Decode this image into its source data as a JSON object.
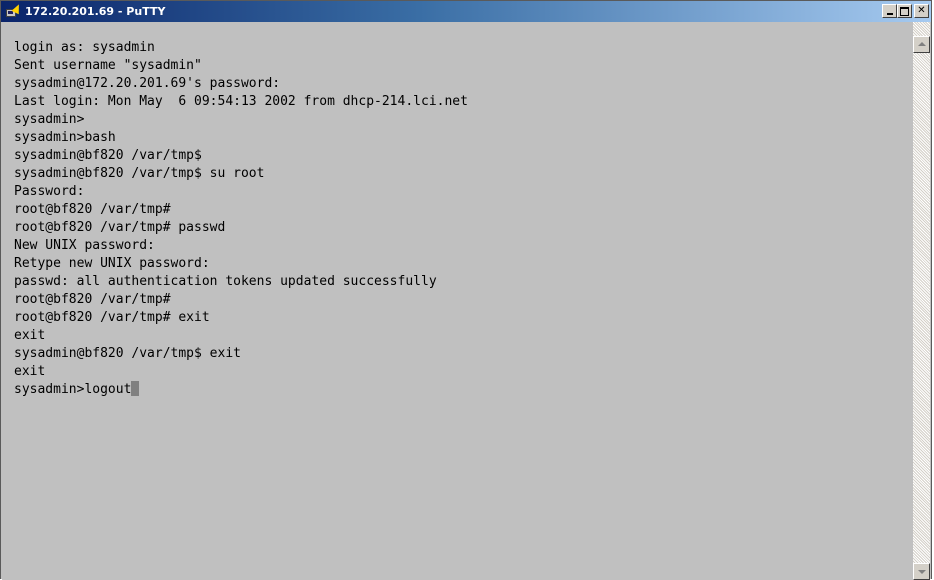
{
  "window": {
    "title": "172.20.201.69 - PuTTY",
    "icon": "putty-icon",
    "controls": [
      "minimize",
      "maximize",
      "close"
    ]
  },
  "terminal": {
    "lines": [
      "login as: sysadmin",
      "Sent username \"sysadmin\"",
      "sysadmin@172.20.201.69's password:",
      "Last login: Mon May  6 09:54:13 2002 from dhcp-214.lci.net",
      "sysadmin>",
      "sysadmin>bash",
      "sysadmin@bf820 /var/tmp$",
      "sysadmin@bf820 /var/tmp$ su root",
      "Password:",
      "root@bf820 /var/tmp#",
      "root@bf820 /var/tmp# passwd",
      "New UNIX password:",
      "Retype new UNIX password:",
      "passwd: all authentication tokens updated successfully",
      "root@bf820 /var/tmp#",
      "root@bf820 /var/tmp# exit",
      "exit",
      "sysadmin@bf820 /var/tmp$ exit",
      "exit",
      "sysadmin>logout"
    ]
  },
  "colors": {
    "terminal_bg": "#c0c0c0",
    "terminal_fg": "#000000",
    "titlebar_start": "#0a246a",
    "titlebar_end": "#a6caf0"
  }
}
